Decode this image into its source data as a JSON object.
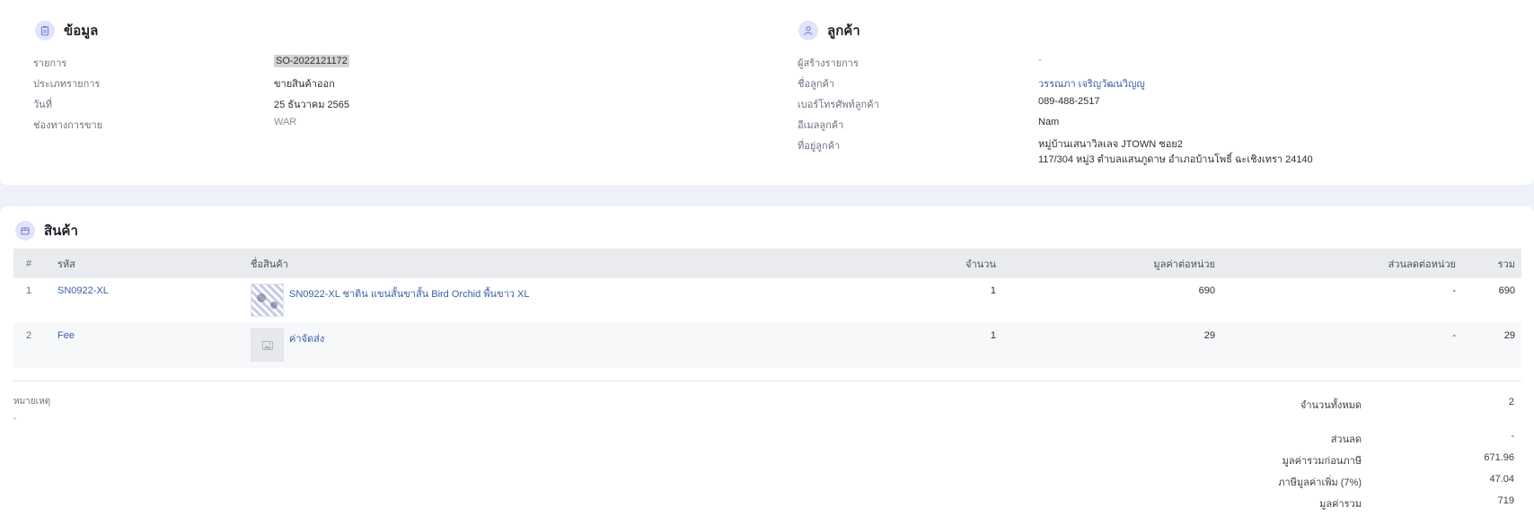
{
  "info": {
    "title": "ข้อมูล",
    "rows": [
      {
        "label": "รายการ",
        "value": "SO-2022121172"
      },
      {
        "label": "ประเภทรายการ",
        "value": "ขายสินค้าออก"
      },
      {
        "label": "วันที่",
        "value": "25 ธันวาคม 2565"
      },
      {
        "label": "ช่องทางการขาย",
        "value": "WAR"
      }
    ]
  },
  "customer": {
    "title": "ลูกค้า",
    "rows": [
      {
        "label": "ผู้สร้างรายการ",
        "value": "-"
      },
      {
        "label": "ชื่อลูกค้า",
        "value": "วรรณภา เจริญวัฒนวิญญู"
      },
      {
        "label": "เบอร์โทรศัพท์ลูกค้า",
        "value": "089-488-2517"
      },
      {
        "label": "อีเมลลูกค้า",
        "value": "Nam"
      },
      {
        "label": "ที่อยู่ลูกค้า",
        "value_line1": "หมู่บ้านเสนาวิลเลจ JTOWN ซอย2",
        "value_line2": "117/304 หมู่3 ตำบลแสนภูดาษ อำเภอบ้านโพธิ์ ฉะเชิงเทรา 24140"
      }
    ]
  },
  "products": {
    "title": "สินค้า",
    "columns": {
      "index": "#",
      "code": "รหัส",
      "name": "ชื่อสินค้า",
      "qty": "จำนวน",
      "unit_price": "มูลค่าต่อหน่วย",
      "unit_discount": "ส่วนลดต่อหน่วย",
      "total": "รวม"
    },
    "items": [
      {
        "index": "1",
        "code": "SN0922-XL",
        "name": "SN0922-XL ชาติน แขนสั้นขาสั้น Bird Orchid พื้นขาว XL",
        "qty": "1",
        "unit_price": "690",
        "unit_discount": "-",
        "total": "690"
      },
      {
        "index": "2",
        "code": "Fee",
        "name": "ค่าจัดส่ง",
        "qty": "1",
        "unit_price": "29",
        "unit_discount": "-",
        "total": "29"
      }
    ]
  },
  "note": {
    "label": "หมายเหตุ",
    "value": "-"
  },
  "summary": [
    {
      "label": "จำนวนทั้งหมด",
      "value": "2"
    },
    {
      "label": "ส่วนลด",
      "value": "-"
    },
    {
      "label": "มูลค่ารวมก่อนภาษี",
      "value": "671.96"
    },
    {
      "label": "ภาษีมูลค่าเพิ่ม (7%)",
      "value": "47.04"
    },
    {
      "label": "มูลค่ารวม",
      "value": "719"
    }
  ],
  "icons": {
    "info": "clipboard-icon",
    "customer": "user-icon",
    "products": "box-icon",
    "placeholder": "image-placeholder-icon"
  },
  "colors": {
    "accent": "#3a5fa8",
    "icon_bg": "#dfe4fb",
    "page_bg": "#eef1f8"
  }
}
